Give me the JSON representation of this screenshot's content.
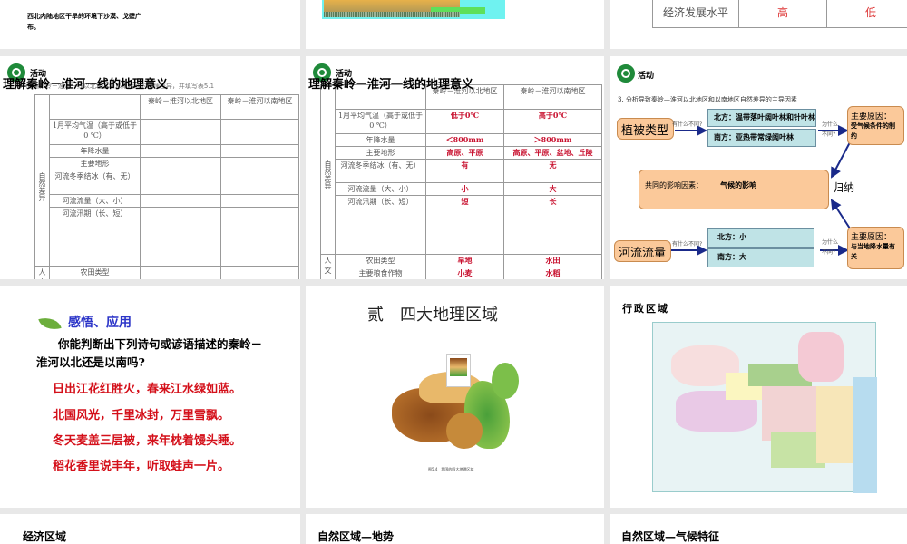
{
  "slides_top": {
    "s1_text": "西北内陆地区干旱的环境下沙漠、戈壁广布。",
    "s3_row_label": "经济发展水平",
    "s3_north": "高",
    "s3_south": "低"
  },
  "activity_label": "活动",
  "table_slide": {
    "title": "理解秦岭－淮河一线的地理意义",
    "instruction": "1. 阅读秦岭－淮河一线以北地区和以南地区的地理差异，并填写表5.1",
    "col_north": "秦岭－淮河以北地区",
    "col_south": "秦岭－淮河以南地区",
    "group_natural": "自然差异",
    "group_human": "人文",
    "rows": [
      {
        "item": "1月平均气温（高于或低于0 ℃）",
        "north": "低于0℃",
        "south": "高于0℃"
      },
      {
        "item": "年降水量",
        "north": "＜800mm",
        "south": "＞800mm"
      },
      {
        "item": "主要地形",
        "north": "高原、平原",
        "south": "高原、平原、盆地、丘陵"
      },
      {
        "item": "河流冬季结冰（有、无）",
        "north": "有",
        "south": "无"
      },
      {
        "item": "河流流量（大、小）",
        "north": "小",
        "south": "大"
      },
      {
        "item": "河流汛期（长、短）",
        "north": "短",
        "south": "长"
      }
    ],
    "human_rows": [
      {
        "item": "农田类型",
        "north": "旱地",
        "south": "水田"
      },
      {
        "item": "主要粮食作物",
        "north": "小麦",
        "south": "水稻"
      }
    ]
  },
  "diagram": {
    "heading": "3. 分析导致秦岭—淮河以北地区和以南地区自然差异的主导因素",
    "veg": "植被类型",
    "river": "河流流量",
    "q1": "有什么不同?",
    "q2": "为什么不同?",
    "veg_north": "北方：温带落叶阔叶林和针叶林",
    "veg_south": "南方：亚热带常绿阔叶林",
    "river_north": "北方：小",
    "river_south": "南方：大",
    "reason_title": "主要原因：",
    "reason1": "受气候条件的制约",
    "reason2": "与当地降水量有关",
    "common_label": "共同的影响因素：",
    "common_value": "气候的影响",
    "summary": "归纳"
  },
  "poem_slide": {
    "heading": "感悟、应用",
    "question": "你能判断出下列诗句或谚语描述的秦岭－淮河以北还是以南吗?",
    "lines": [
      "日出江花红胜火，春来江水绿如蓝。",
      "北国风光，千里冰封，万里雪飘。",
      "冬天麦盖三层被，来年枕着馒头睡。",
      "稻花香里说丰年，听取蛙声一片。"
    ]
  },
  "regions_slide": {
    "title": "贰　四大地理区域",
    "caption": "图5.4　我国的四大地理区域"
  },
  "admin_slide": {
    "title": "行政区域"
  },
  "bottom": {
    "s1": "经济区域",
    "s2": "自然区域—地势",
    "s3": "自然区域—气候特征"
  }
}
